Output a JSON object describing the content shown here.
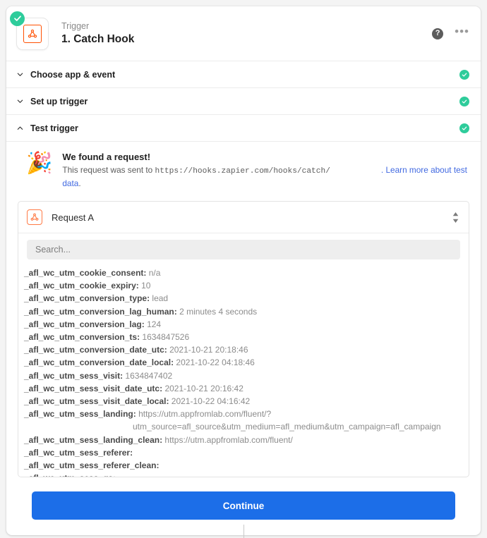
{
  "app": {
    "background_color": "#f4f4f4",
    "accent_color": "#1c6ee8",
    "success_color": "#2ecc9b",
    "brand_color": "#ff4f00"
  },
  "header": {
    "kicker": "Trigger",
    "title": "1. Catch Hook",
    "app_icon_name": "webhooks-icon",
    "help_label": "?",
    "more_label": "•••"
  },
  "sections": [
    {
      "label": "Choose app & event",
      "expanded": false,
      "complete": true
    },
    {
      "label": "Set up trigger",
      "expanded": false,
      "complete": true
    },
    {
      "label": "Test trigger",
      "expanded": true,
      "complete": true
    }
  ],
  "test_panel": {
    "emoji": "🎉",
    "found_title": "We found a request!",
    "found_prefix": "This request was sent to ",
    "found_url": "https://hooks.zapier.com/hooks/catch/",
    "link_tail_1": ". Learn more about test",
    "link_tail_2": "data",
    "link_period": ".",
    "request_select": {
      "label": "Request A",
      "icon_name": "webhooks-icon"
    },
    "search": {
      "placeholder": "Search..."
    },
    "fields": [
      {
        "key": "_afl_wc_utm_cookie_consent:",
        "value": "n/a"
      },
      {
        "key": "_afl_wc_utm_cookie_expiry:",
        "value": "10"
      },
      {
        "key": "_afl_wc_utm_conversion_type:",
        "value": "lead"
      },
      {
        "key": "_afl_wc_utm_conversion_lag_human:",
        "value": "2 minutes 4 seconds"
      },
      {
        "key": "_afl_wc_utm_conversion_lag:",
        "value": "124"
      },
      {
        "key": "_afl_wc_utm_conversion_ts:",
        "value": "1634847526"
      },
      {
        "key": "_afl_wc_utm_conversion_date_utc:",
        "value": "2021-10-21 20:18:46"
      },
      {
        "key": "_afl_wc_utm_conversion_date_local:",
        "value": "2021-10-22 04:18:46"
      },
      {
        "key": "_afl_wc_utm_sess_visit:",
        "value": "1634847402"
      },
      {
        "key": "_afl_wc_utm_sess_visit_date_utc:",
        "value": "2021-10-21 20:16:42"
      },
      {
        "key": "_afl_wc_utm_sess_visit_date_local:",
        "value": "2021-10-22 04:16:42"
      },
      {
        "key": "_afl_wc_utm_sess_landing:",
        "value": "https://utm.appfromlab.com/fluent/?"
      },
      {
        "key": "",
        "value": "utm_source=afl_source&utm_medium=afl_medium&utm_campaign=afl_campaign",
        "continuation": true
      },
      {
        "key": "_afl_wc_utm_sess_landing_clean:",
        "value": "https://utm.appfromlab.com/fluent/"
      },
      {
        "key": "_afl_wc_utm_sess_referer:",
        "value": ""
      },
      {
        "key": "_afl_wc_utm_sess_referer_clean:",
        "value": ""
      },
      {
        "key": "_afl_wc_utm_sess_ga:",
        "value": ""
      }
    ],
    "continue_label": "Continue"
  }
}
